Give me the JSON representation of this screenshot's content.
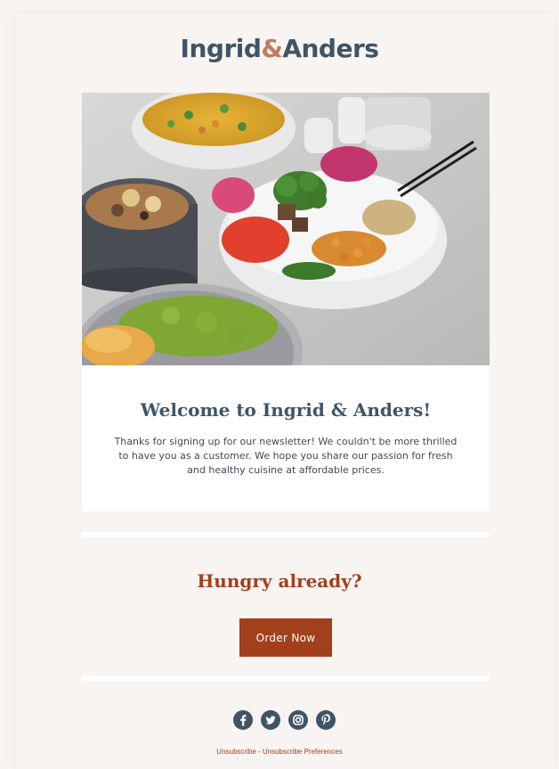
{
  "brand": {
    "name_part1": "Ingrid",
    "ampersand": "&",
    "name_part2": "Anders"
  },
  "hero": {
    "image_icon": "food-bowls-photo"
  },
  "welcome": {
    "title": "Welcome to Ingrid & Anders!",
    "body": "Thanks for signing up for our newsletter! We couldn't be more thrilled to have you as a customer. We hope you share our passion for fresh and healthy cuisine at affordable prices."
  },
  "cta": {
    "heading": "Hungry already?",
    "button_label": "Order Now"
  },
  "social": {
    "icons": [
      "facebook-icon",
      "twitter-icon",
      "instagram-icon",
      "pinterest-icon"
    ]
  },
  "footer": {
    "unsubscribe": "Unsubscribe",
    "separator": " - ",
    "preferences": "Unsubscribe Preferences"
  },
  "colors": {
    "background": "#f8f4f1",
    "brand_slate": "#3f5566",
    "accent_rust": "#a3401c",
    "ampersand": "#c17b5e"
  }
}
